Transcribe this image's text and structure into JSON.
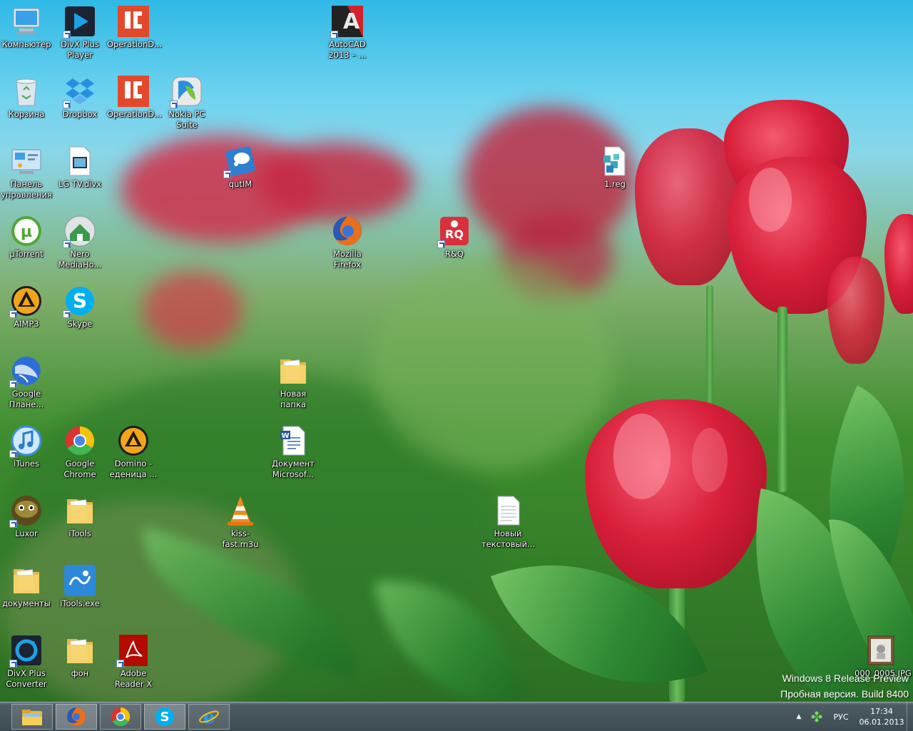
{
  "desktop_icons": [
    {
      "id": "computer",
      "label": "Компьютер",
      "icon": "computer-icon",
      "shortcut": false
    },
    {
      "id": "divx-player",
      "label": "DivX Plus\nPlayer",
      "icon": "divx-player-icon",
      "shortcut": true
    },
    {
      "id": "operationd-1",
      "label": "OperationD...",
      "icon": "operationd-icon",
      "shortcut": false
    },
    {
      "id": "autocad",
      "label": "AutoCAD\n2013 – ...",
      "icon": "autocad-icon",
      "shortcut": true
    },
    {
      "id": "recycle-bin",
      "label": "Корзина",
      "icon": "recycle-bin-icon",
      "shortcut": false
    },
    {
      "id": "dropbox",
      "label": "Dropbox",
      "icon": "dropbox-icon",
      "shortcut": true
    },
    {
      "id": "operationd-2",
      "label": "OperationD...",
      "icon": "operationd-icon",
      "shortcut": false
    },
    {
      "id": "nokia-pc-suite",
      "label": "Nokia PC\nSuite",
      "icon": "nokia-pc-suite-icon",
      "shortcut": true
    },
    {
      "id": "control-panel",
      "label": "Панель\nуправления",
      "icon": "control-panel-icon",
      "shortcut": false
    },
    {
      "id": "lg-tv",
      "label": "LG TV.divx",
      "icon": "video-file-icon",
      "shortcut": false
    },
    {
      "id": "qutim",
      "label": "qutIM",
      "icon": "qutim-icon",
      "shortcut": true
    },
    {
      "id": "reg-file",
      "label": "1.reg",
      "icon": "registry-file-icon",
      "shortcut": false
    },
    {
      "id": "utorrent",
      "label": "µTorrent",
      "icon": "utorrent-icon",
      "shortcut": false
    },
    {
      "id": "nero",
      "label": "Nero\nMediaHo...",
      "icon": "nero-icon",
      "shortcut": true
    },
    {
      "id": "firefox",
      "label": "Mozilla\nFirefox",
      "icon": "firefox-icon",
      "shortcut": false
    },
    {
      "id": "rq",
      "label": "R&Q",
      "icon": "rq-icon",
      "shortcut": true
    },
    {
      "id": "aimp3",
      "label": "AIMP3",
      "icon": "aimp-icon",
      "shortcut": true
    },
    {
      "id": "skype",
      "label": "Skype",
      "icon": "skype-icon",
      "shortcut": true
    },
    {
      "id": "google-earth",
      "label": "Google\nПлане...",
      "icon": "google-earth-icon",
      "shortcut": true
    },
    {
      "id": "new-folder",
      "label": "Новая папка",
      "icon": "folder-icon",
      "shortcut": false
    },
    {
      "id": "itunes",
      "label": "iTunes",
      "icon": "itunes-icon",
      "shortcut": true
    },
    {
      "id": "chrome",
      "label": "Google\nChrome",
      "icon": "chrome-icon",
      "shortcut": false
    },
    {
      "id": "domino",
      "label": "Domino -\nеденица ...",
      "icon": "aimp-icon",
      "shortcut": false
    },
    {
      "id": "word-doc",
      "label": "Документ\nMicrosof...",
      "icon": "word-document-icon",
      "shortcut": false
    },
    {
      "id": "luxor",
      "label": "Luxor",
      "icon": "luxor-icon",
      "shortcut": true
    },
    {
      "id": "itools",
      "label": "iTools",
      "icon": "folder-icon",
      "shortcut": false
    },
    {
      "id": "kiss-fast",
      "label": "kiss-fast.m3u",
      "icon": "vlc-icon",
      "shortcut": false
    },
    {
      "id": "text-file",
      "label": "Новый\nтекстовый...",
      "icon": "text-file-icon",
      "shortcut": false
    },
    {
      "id": "documents",
      "label": "документы",
      "icon": "folder-icon",
      "shortcut": false
    },
    {
      "id": "itools-exe",
      "label": "iTools.exe",
      "icon": "itools-exe-icon",
      "shortcut": false
    },
    {
      "id": "divx-converter",
      "label": "DivX Plus\nConverter",
      "icon": "divx-converter-icon",
      "shortcut": true
    },
    {
      "id": "fon",
      "label": "фон",
      "icon": "folder-icon",
      "shortcut": false
    },
    {
      "id": "adobe-reader",
      "label": "Adobe\nReader X",
      "icon": "adobe-reader-icon",
      "shortcut": true
    },
    {
      "id": "jpg-file",
      "label": "000_0005.JPG",
      "icon": "image-file-icon",
      "shortcut": false
    }
  ],
  "watermark": {
    "line1": "Windows 8 Release Preview",
    "line2": "Пробная версия. Build 8400"
  },
  "taskbar": {
    "buttons": [
      {
        "id": "explorer",
        "icon": "file-explorer-icon",
        "active": false
      },
      {
        "id": "firefox",
        "icon": "firefox-icon",
        "active": true
      },
      {
        "id": "chrome",
        "icon": "chrome-icon",
        "active": false
      },
      {
        "id": "skype",
        "icon": "skype-icon",
        "active": true
      },
      {
        "id": "ie",
        "icon": "internet-explorer-icon",
        "active": false
      }
    ],
    "tray": {
      "show_hidden_icon": "▲",
      "language": "РУС",
      "time": "17:34",
      "date": "06.01.2013"
    }
  }
}
